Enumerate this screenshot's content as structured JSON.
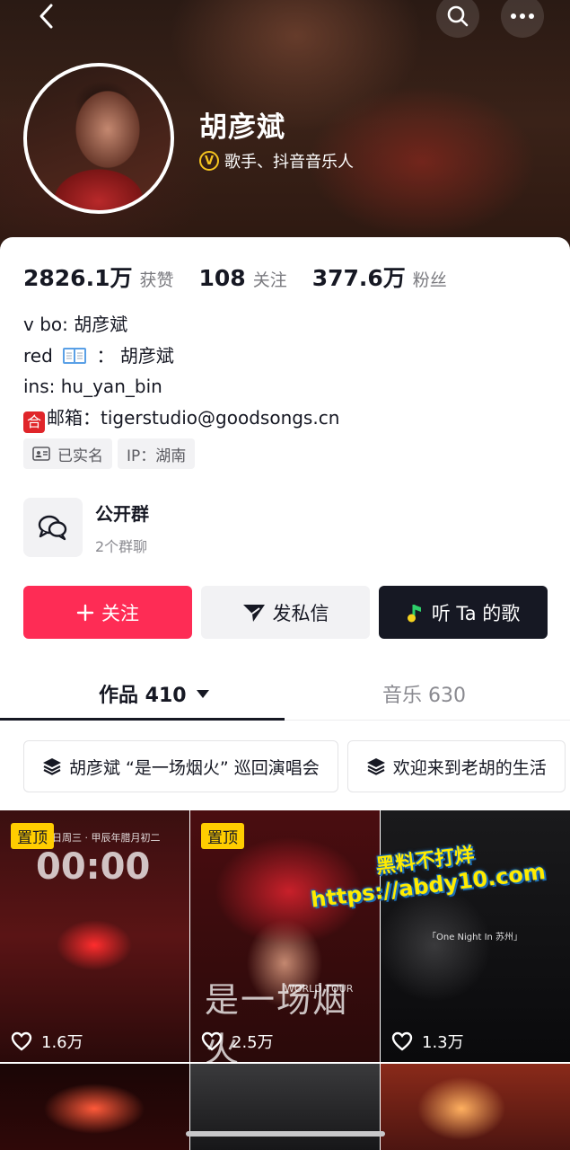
{
  "header": {
    "name": "胡彦斌",
    "verify_text": "歌手、抖音音乐人",
    "verify_badge": "V"
  },
  "stats": [
    {
      "value": "2826.1万",
      "label": "获赞"
    },
    {
      "value": "108",
      "label": "关注"
    },
    {
      "value": "377.6万",
      "label": "粉丝"
    }
  ],
  "bio": {
    "line1": "v bo:   胡彦斌",
    "line2_prefix": "red",
    "line2_suffix": "：  胡彦斌",
    "line3": "ins: hu_yan_bin",
    "line4_badge": "合",
    "line4": "邮箱：tigerstudio@goodsongs.cn"
  },
  "tags": {
    "verified": "已实名",
    "ip": "IP：湖南"
  },
  "group": {
    "title": "公开群",
    "subtitle": "2个群聊"
  },
  "actions": {
    "follow": "关注",
    "message": "发私信",
    "listen": "听 Ta 的歌"
  },
  "tabs": {
    "works": "作品 410",
    "music": "音乐 630"
  },
  "collections": [
    {
      "label": "胡彦斌 “是一场烟火” 巡回演唱会"
    },
    {
      "label": "欢迎来到老胡的生活"
    }
  ],
  "videos": [
    {
      "pinned": "置顶",
      "likes": "1.6万",
      "overlay_top": "1月日周三 · 甲辰年腊月初二",
      "overlay_main": "00:00"
    },
    {
      "pinned": "置顶",
      "likes": "2.5万",
      "overlay_main": "是一场烟火",
      "overlay_sub": "WORLD TOUR"
    },
    {
      "likes": "1.3万",
      "overlay_main": "「One Night In 苏州」"
    }
  ],
  "watermark": {
    "line1": "黑料不打烊",
    "line2": "https://abdy10.com"
  },
  "colors": {
    "accent": "#fe2c55",
    "dark": "#161823",
    "pin": "#ffcd00",
    "verify": "#f5c41f"
  }
}
